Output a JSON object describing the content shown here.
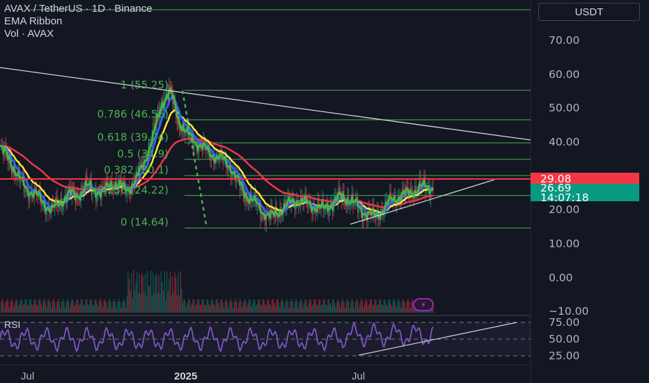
{
  "legend": {
    "title": "AVAX / TetherUS · 1D · Binance",
    "indicator": "EMA Ribbon",
    "volume": "Vol · AVAX"
  },
  "currency_button": "USDT",
  "price_axis": [
    "70.00",
    "60.00",
    "50.00",
    "40.00",
    "20.00",
    "10.00",
    "0.00",
    "−10.00"
  ],
  "price_tags": {
    "red": "29.08",
    "current": "26.69",
    "countdown": "14:07:18"
  },
  "fib_labels": [
    "1 (55.25)",
    "0.786 (46.56)",
    "0.618 (39.74)",
    "0.5 (34.9)",
    "0.382 (30.1)",
    "0.236 (24.22)",
    "0 (14.64)"
  ],
  "rsi": {
    "label": "RSI",
    "axis": [
      "75.00",
      "50.00",
      "25.00"
    ]
  },
  "time_axis": [
    {
      "label": "Jul",
      "bold": false
    },
    {
      "label": "2025",
      "bold": true
    },
    {
      "label": "Jul",
      "bold": false
    }
  ],
  "colors": {
    "background": "#131722",
    "fib": "#4caf50",
    "red_level": "#f23645",
    "current_price": "#089981",
    "ema_fast": "#4caf50",
    "ema_mid": "#2962ff",
    "ema_slow": "#ffeb3b",
    "ema_long": "#f23645",
    "rsi_line": "#7e57c2"
  },
  "icons": {
    "alert": "lightning-icon"
  },
  "chart_data": {
    "type": "line",
    "title": "AVAX / TetherUS · 1D · Binance",
    "xlabel": "",
    "ylabel": "",
    "ylim": [
      -10,
      80
    ],
    "x_ticks": [
      "Jul",
      "2025",
      "Jul"
    ],
    "fib_levels": [
      {
        "ratio": "1",
        "price": 55.25
      },
      {
        "ratio": "0.786",
        "price": 46.56
      },
      {
        "ratio": "0.618",
        "price": 39.74
      },
      {
        "ratio": "0.5",
        "price": 34.9
      },
      {
        "ratio": "0.382",
        "price": 30.1
      },
      {
        "ratio": "0.236",
        "price": 24.22
      },
      {
        "ratio": "0",
        "price": 14.64
      }
    ],
    "series": [
      {
        "name": "AVAX",
        "values": [
          38,
          35,
          30,
          26,
          25,
          22,
          20,
          22,
          25,
          24,
          27,
          26,
          25,
          28,
          27,
          26,
          29,
          35,
          42,
          52,
          55,
          46,
          42,
          40,
          38,
          36,
          35,
          33,
          28,
          24,
          22,
          19,
          18,
          20,
          22,
          23,
          22,
          21,
          20,
          22,
          24,
          23,
          21,
          19,
          18,
          20,
          23,
          24,
          25,
          26,
          27,
          26.69
        ]
      }
    ],
    "rsi": {
      "ylim": [
        25,
        75
      ],
      "levels": [
        70,
        50,
        30
      ]
    }
  }
}
